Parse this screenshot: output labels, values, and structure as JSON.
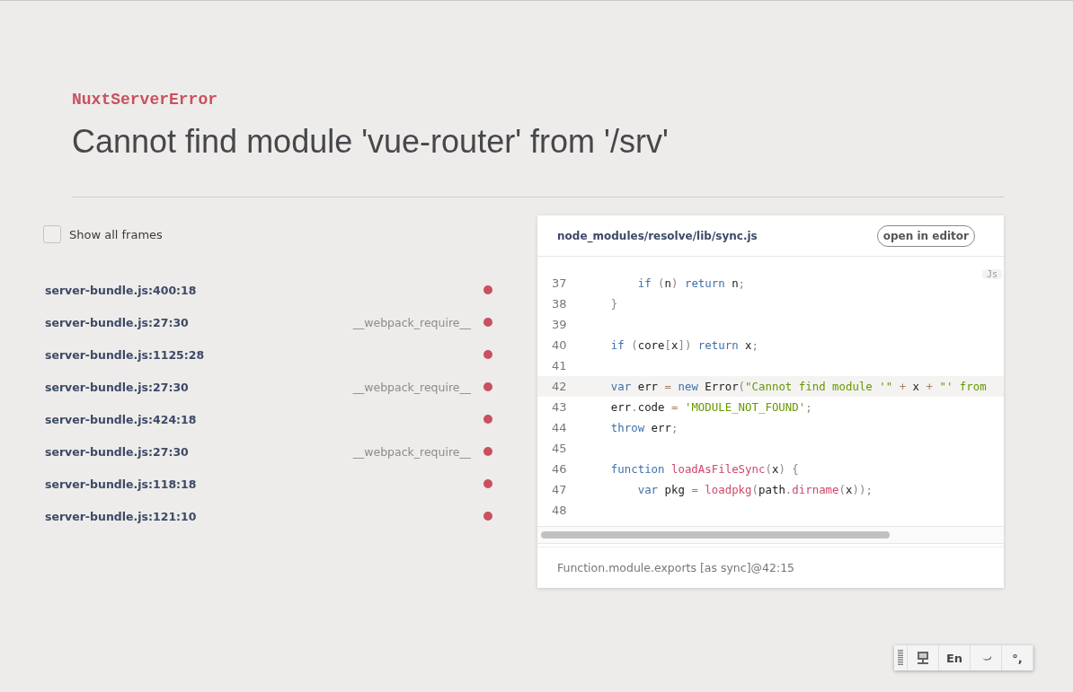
{
  "error": {
    "name": "NuxtServerError",
    "message": "Cannot find module 'vue-router' from '/srv'"
  },
  "show_all_frames": {
    "label": "Show all frames",
    "checked": false
  },
  "frames": [
    {
      "file": "server-bundle.js:400:18",
      "selected": false
    },
    {
      "file": "server-bundle.js:27:30",
      "function": "__webpack_require__",
      "selected": false
    },
    {
      "file": "server-bundle.js:1125:28",
      "selected": false
    },
    {
      "file": "server-bundle.js:27:30",
      "function": "__webpack_require__",
      "selected": false
    },
    {
      "file": "server-bundle.js:424:18",
      "selected": false
    },
    {
      "file": "server-bundle.js:27:30",
      "function": "__webpack_require__",
      "selected": false
    },
    {
      "file": "server-bundle.js:118:18",
      "selected": false
    },
    {
      "file": "server-bundle.js:121:10",
      "selected": false
    }
  ],
  "source": {
    "path": "node_modules/resolve/lib/sync.js",
    "open_button": "open in editor",
    "language_badge": "Js",
    "lines": [
      {
        "number": "37",
        "highlighted": false,
        "tokens": [
          {
            "text": "        if",
            "kind": "kw"
          },
          {
            "text": " (",
            "kind": "punct"
          },
          {
            "text": "n",
            "kind": "plain"
          },
          {
            "text": ") ",
            "kind": "punct"
          },
          {
            "text": "return",
            "kind": "kw"
          },
          {
            "text": " n",
            "kind": "plain"
          },
          {
            "text": ";",
            "kind": "punct"
          }
        ]
      },
      {
        "number": "38",
        "highlighted": false,
        "tokens": [
          {
            "text": "    }",
            "kind": "punct"
          }
        ]
      },
      {
        "number": "39",
        "highlighted": false
      },
      {
        "number": "40",
        "highlighted": false,
        "tokens": [
          {
            "text": "    if",
            "kind": "kw"
          },
          {
            "text": " (",
            "kind": "punct"
          },
          {
            "text": "core",
            "kind": "plain"
          },
          {
            "text": "[",
            "kind": "punct"
          },
          {
            "text": "x",
            "kind": "plain"
          },
          {
            "text": "]) ",
            "kind": "punct"
          },
          {
            "text": "return",
            "kind": "kw"
          },
          {
            "text": " x",
            "kind": "plain"
          },
          {
            "text": ";",
            "kind": "punct"
          }
        ]
      },
      {
        "number": "41",
        "highlighted": false
      },
      {
        "number": "42",
        "highlighted": true,
        "tokens": [
          {
            "text": "    var",
            "kind": "kw"
          },
          {
            "text": " err ",
            "kind": "plain"
          },
          {
            "text": "=",
            "kind": "op"
          },
          {
            "text": " new",
            "kind": "kw"
          },
          {
            "text": " Error",
            "kind": "plain"
          },
          {
            "text": "(",
            "kind": "punct"
          },
          {
            "text": "\"Cannot find module '\"",
            "kind": "str"
          },
          {
            "text": " + ",
            "kind": "op"
          },
          {
            "text": "x",
            "kind": "plain"
          },
          {
            "text": " + ",
            "kind": "op"
          },
          {
            "text": "\"' from",
            "kind": "str"
          }
        ]
      },
      {
        "number": "43",
        "highlighted": false,
        "tokens": [
          {
            "text": "    err",
            "kind": "plain"
          },
          {
            "text": ".",
            "kind": "punct"
          },
          {
            "text": "code ",
            "kind": "plain"
          },
          {
            "text": "=",
            "kind": "op"
          },
          {
            "text": " 'MODULE_NOT_FOUND'",
            "kind": "str"
          },
          {
            "text": ";",
            "kind": "punct"
          }
        ]
      },
      {
        "number": "44",
        "highlighted": false,
        "tokens": [
          {
            "text": "    throw",
            "kind": "kw"
          },
          {
            "text": " err",
            "kind": "plain"
          },
          {
            "text": ";",
            "kind": "punct"
          }
        ]
      },
      {
        "number": "45",
        "highlighted": false
      },
      {
        "number": "46",
        "highlighted": false,
        "tokens": [
          {
            "text": "    function",
            "kind": "kw"
          },
          {
            "text": " loadAsFileSync",
            "kind": "fn"
          },
          {
            "text": "(",
            "kind": "punct"
          },
          {
            "text": "x",
            "kind": "plain"
          },
          {
            "text": ") {",
            "kind": "punct"
          }
        ]
      },
      {
        "number": "47",
        "highlighted": false,
        "tokens": [
          {
            "text": "        var",
            "kind": "kw"
          },
          {
            "text": " pkg ",
            "kind": "plain"
          },
          {
            "text": "=",
            "kind": "op"
          },
          {
            "text": " loadpkg",
            "kind": "fn"
          },
          {
            "text": "(",
            "kind": "punct"
          },
          {
            "text": "path",
            "kind": "plain"
          },
          {
            "text": ".",
            "kind": "punct"
          },
          {
            "text": "dirname",
            "kind": "fn"
          },
          {
            "text": "(",
            "kind": "punct"
          },
          {
            "text": "x",
            "kind": "plain"
          },
          {
            "text": "));",
            "kind": "punct"
          }
        ]
      },
      {
        "number": "48",
        "highlighted": false
      }
    ],
    "footer": "Function.module.exports [as sync]@42:15"
  },
  "ime_toolbar": {
    "language": "En",
    "punctuation": "°,"
  }
}
